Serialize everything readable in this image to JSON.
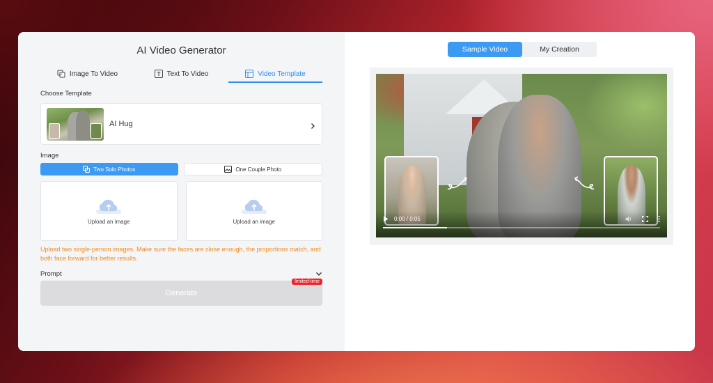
{
  "app": {
    "title": "AI Video Generator"
  },
  "tabs": [
    {
      "label": "Image To Video",
      "icon": "image-to-video-icon"
    },
    {
      "label": "Text To Video",
      "icon": "text-icon"
    },
    {
      "label": "Video Template",
      "icon": "template-icon",
      "active": true
    }
  ],
  "template": {
    "section_label": "Choose Template",
    "selected_name": "AI Hug"
  },
  "image": {
    "section_label": "Image",
    "modes": [
      {
        "label": "Two Solo Photos",
        "active": true
      },
      {
        "label": "One Couple Photo",
        "active": false
      }
    ],
    "uploads": [
      {
        "label": "Upload an image"
      },
      {
        "label": "Upload an image"
      }
    ],
    "hint": "Upload two single-person images. Make sure the faces are close enough, the proportions match, and both face forward for better results."
  },
  "prompt": {
    "label": "Prompt"
  },
  "generate": {
    "label": "Generate",
    "badge": "limited-time"
  },
  "preview": {
    "tabs": [
      {
        "label": "Sample Video",
        "active": true
      },
      {
        "label": "My Creation",
        "active": false
      }
    ],
    "video": {
      "time": "0:00 / 0:05",
      "progress": 0.23
    }
  },
  "colors": {
    "accent": "#3d9af2",
    "hint": "#f08a1c",
    "badge": "#e8262b"
  }
}
